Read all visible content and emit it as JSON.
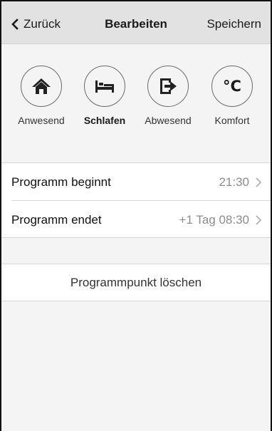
{
  "header": {
    "back_label": "Zurück",
    "title": "Bearbeiten",
    "save_label": "Speichern"
  },
  "modes": [
    {
      "label": "Anwesend",
      "icon": "home-icon",
      "selected": false
    },
    {
      "label": "Schlafen",
      "icon": "bed-icon",
      "selected": true
    },
    {
      "label": "Abwesend",
      "icon": "exit-icon",
      "selected": false
    },
    {
      "label": "Komfort",
      "icon": "celsius-icon",
      "symbol": "°C",
      "selected": false
    }
  ],
  "program": {
    "start_label": "Programm beginnt",
    "start_value": "21:30",
    "end_label": "Programm endet",
    "end_value": "+1 Tag 08:30"
  },
  "actions": {
    "delete_label": "Programmpunkt löschen"
  },
  "colors": {
    "header_bg": "#e2e2e2",
    "background": "#f4f4f4",
    "row_bg": "#ffffff",
    "value_text": "#8c8c8c"
  }
}
